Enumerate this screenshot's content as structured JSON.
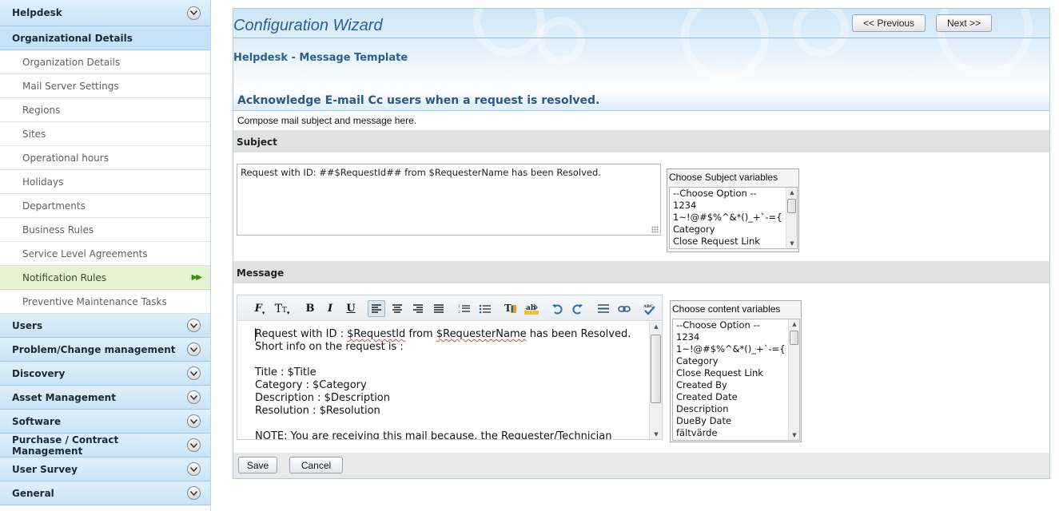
{
  "sidebar": {
    "helpdesk": "Helpdesk",
    "org_details_header": "Organizational Details",
    "items": [
      "Organization Details",
      "Mail Server Settings",
      "Regions",
      "Sites",
      "Operational hours",
      "Holidays",
      "Departments",
      "Business Rules",
      "Service Level Agreements",
      "Notification Rules",
      "Preventive Maintenance Tasks"
    ],
    "active_item": "Notification Rules",
    "sections": [
      "Users",
      "Problem/Change management",
      "Discovery",
      "Asset Management",
      "Software",
      "Purchase / Contract Management",
      "User Survey",
      "General"
    ]
  },
  "header": {
    "title": "Configuration Wizard",
    "subtitle": "Helpdesk - Message Template",
    "previous_label": "<< Previous",
    "next_label": "Next >>"
  },
  "form": {
    "section_title": "Acknowledge E-mail Cc users when a request is resolved.",
    "compose_hint": "Compose mail subject and message here.",
    "subject_label": "Subject",
    "subject_value": "Request with ID: ##$RequestId## from $RequesterName has been Resolved.",
    "subject_vars_title": "Choose Subject variables",
    "subject_vars": [
      "--Choose Option --",
      "1234",
      "1~!@#$%^&*()_+`-={",
      "Category",
      "Close Request Link"
    ],
    "message_label": "Message",
    "message_lines": [
      [
        "Request with ID : ",
        "$RequestId",
        " from ",
        "$RequesterName",
        " has been Resolved."
      ],
      "Short info on the request is :",
      "",
      "Title : $Title",
      "Category : $Category",
      "Description : $Description",
      "Resolution : $Resolution",
      "",
      "NOTE: You are receiving this mail because, the Requester/Technician"
    ],
    "content_vars_title": "Choose content variables",
    "content_vars": [
      "--Choose Option --",
      "1234",
      "1~!@#$%^&*()_+`-={",
      "Category",
      "Close Request Link",
      "Created By",
      "Created Date",
      "Description",
      "DueBy Date",
      "fältvärde"
    ],
    "save_label": "Save",
    "cancel_label": "Cancel"
  },
  "toolbar_icons": [
    "font-family-icon",
    "font-size-icon",
    "bold-icon",
    "italic-icon",
    "underline-icon",
    "align-left-icon",
    "align-center-icon",
    "align-right-icon",
    "justify-icon",
    "numbered-list-icon",
    "bullet-list-icon",
    "text-color-icon",
    "background-color-icon",
    "undo-icon",
    "redo-icon",
    "horizontal-rule-icon",
    "insert-link-icon",
    "spellcheck-icon"
  ],
  "colors": {
    "sidebar_header": "#c9e4f7",
    "active_item": "#e5f3d3",
    "title_blue": "#2a5f95",
    "border_blue": "#a7cde8"
  }
}
